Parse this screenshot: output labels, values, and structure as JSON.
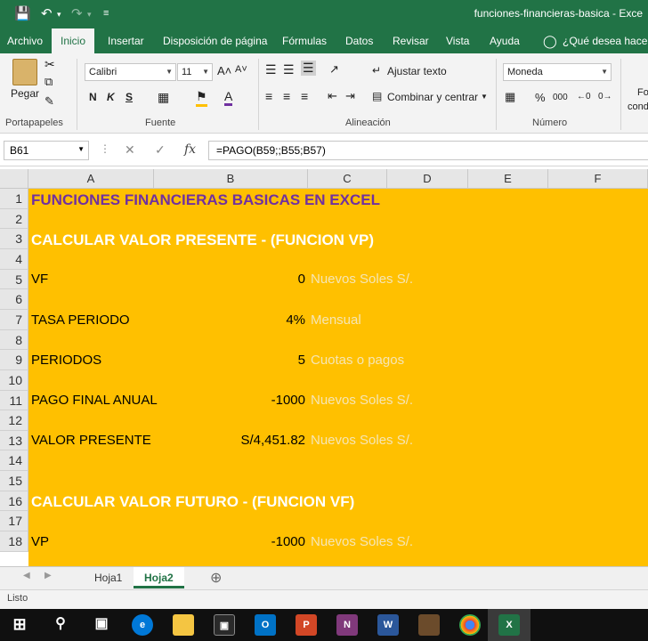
{
  "window": {
    "title": "funciones-financieras-basica  -  Exce"
  },
  "quick_access": {
    "save_icon": "save-icon",
    "undo_icon": "undo-icon",
    "redo_icon": "redo-icon"
  },
  "tabs": [
    {
      "label": "Archivo"
    },
    {
      "label": "Inicio"
    },
    {
      "label": "Insertar"
    },
    {
      "label": "Disposición de página"
    },
    {
      "label": "Fórmulas"
    },
    {
      "label": "Datos"
    },
    {
      "label": "Revisar"
    },
    {
      "label": "Vista"
    },
    {
      "label": "Ayuda"
    }
  ],
  "tell_me": "¿Qué desea hacer?",
  "ribbon": {
    "clipboard": {
      "paste": "Pegar",
      "label": "Portapapeles"
    },
    "font": {
      "name": "Calibri",
      "size": "11",
      "bold": "N",
      "italic": "K",
      "underline": "S",
      "label": "Fuente"
    },
    "alignment": {
      "wrap": "Ajustar texto",
      "merge": "Combinar y centrar",
      "label": "Alineación"
    },
    "number": {
      "format": "Moneda",
      "percent": "%",
      "thousands": "000",
      "label": "Número"
    },
    "styles": {
      "partial": "Fo",
      "partial2": "condi"
    }
  },
  "formula_bar": {
    "name_box": "B61",
    "formula": "=PAGO(B59;;B55;B57)"
  },
  "columns": [
    "A",
    "B",
    "C",
    "D",
    "E",
    "F"
  ],
  "rows": [
    {
      "num": "1",
      "a": "FUNCIONES FINANCIERAS BASICAS EN EXCEL",
      "b": "",
      "c": ""
    },
    {
      "num": "2",
      "a": "",
      "b": "",
      "c": ""
    },
    {
      "num": "3",
      "a": "CALCULAR VALOR PRESENTE - (FUNCION VP)",
      "b": "",
      "c": ""
    },
    {
      "num": "4",
      "a": "",
      "b": "",
      "c": ""
    },
    {
      "num": "5",
      "a": "VF",
      "b": "0",
      "c": "Nuevos Soles S/."
    },
    {
      "num": "6",
      "a": "",
      "b": "",
      "c": ""
    },
    {
      "num": "7",
      "a": "TASA PERIODO",
      "b": "4%",
      "c": "Mensual"
    },
    {
      "num": "8",
      "a": "",
      "b": "",
      "c": ""
    },
    {
      "num": "9",
      "a": "PERIODOS",
      "b": "5",
      "c": "Cuotas o pagos"
    },
    {
      "num": "10",
      "a": "",
      "b": "",
      "c": ""
    },
    {
      "num": "11",
      "a": "PAGO FINAL ANUAL",
      "b": "-1000",
      "c": "Nuevos Soles S/."
    },
    {
      "num": "12",
      "a": "",
      "b": "",
      "c": ""
    },
    {
      "num": "13",
      "a": "VALOR PRESENTE",
      "b": "S/4,451.82",
      "c": "Nuevos Soles S/."
    },
    {
      "num": "14",
      "a": "",
      "b": "",
      "c": ""
    },
    {
      "num": "15",
      "a": "",
      "b": "",
      "c": ""
    },
    {
      "num": "16",
      "a": "CALCULAR VALOR FUTURO - (FUNCION VF)",
      "b": "",
      "c": ""
    },
    {
      "num": "17",
      "a": "",
      "b": "",
      "c": ""
    },
    {
      "num": "18",
      "a": "VP",
      "b": "-1000",
      "c": "Nuevos Soles S/."
    }
  ],
  "sheets": [
    {
      "label": "Hoja1"
    },
    {
      "label": "Hoja2"
    }
  ],
  "status": "Listo",
  "colors": {
    "excel_green": "#217346",
    "cell_fill": "#ffc000",
    "title_purple": "#7030a0"
  }
}
